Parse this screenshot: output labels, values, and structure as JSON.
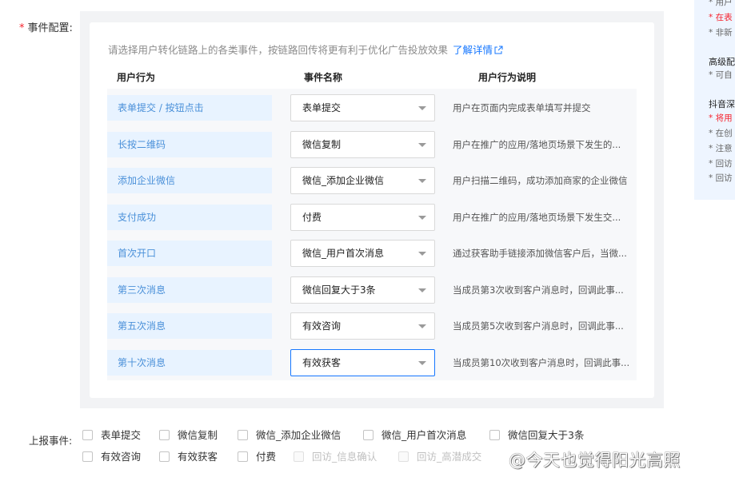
{
  "form": {
    "required_mark": "*",
    "event_config_label": "事件配置:",
    "hint_text": "请选择用户转化链路上的各类事件，按链路回传将更有利于优化广告投放效果",
    "learn_more": "了解详情",
    "headers": {
      "behavior": "用户行为",
      "event_name": "事件名称",
      "description": "用户行为说明"
    },
    "rows": [
      {
        "behavior": "表单提交 / 按钮点击",
        "event": "表单提交",
        "desc": "用户在页面内完成表单填写并提交"
      },
      {
        "behavior": "长按二维码",
        "event": "微信复制",
        "desc": "用户在推广的应用/落地页场景下发生的..."
      },
      {
        "behavior": "添加企业微信",
        "event": "微信_添加企业微信",
        "desc": "用户扫描二维码，成功添加商家的企业微信"
      },
      {
        "behavior": "支付成功",
        "event": "付费",
        "desc": "用户在推广的应用/落地页场景下发生交..."
      },
      {
        "behavior": "首次开口",
        "event": "微信_用户首次消息",
        "desc": "通过获客助手链接添加微信客户后，当微..."
      },
      {
        "behavior": "第三次消息",
        "event": "微信回复大于3条",
        "desc": "当成员第3次收到客户消息时，回调此事..."
      },
      {
        "behavior": "第五次消息",
        "event": "有效咨询",
        "desc": "当成员第5次收到客户消息时，回调此事..."
      },
      {
        "behavior": "第十次消息",
        "event": "有效获客",
        "desc": "当成员第10次收到客户消息时，回调此事..."
      }
    ]
  },
  "report": {
    "label": "上报事件:",
    "items": [
      {
        "label": "表单提交",
        "disabled": false
      },
      {
        "label": "微信复制",
        "disabled": false
      },
      {
        "label": "微信_添加企业微信",
        "disabled": false
      },
      {
        "label": "微信_用户首次消息",
        "disabled": false
      },
      {
        "label": "微信回复大于3条",
        "disabled": false
      },
      {
        "label": "有效咨询",
        "disabled": false
      },
      {
        "label": "有效获客",
        "disabled": false
      },
      {
        "label": "付费",
        "disabled": false
      },
      {
        "label": "回访_信息确认",
        "disabled": true
      },
      {
        "label": "回访_高潜成交",
        "disabled": true
      }
    ]
  },
  "side_panel": {
    "lines": [
      "* 用户",
      "* 在表",
      "* 非新",
      "高级配",
      "* 可自",
      "抖音深",
      "* 将用",
      "* 在创",
      "* 注意",
      "* 回访",
      "* 回访"
    ]
  },
  "watermark": "@今天也觉得阳光高照",
  "colors": {
    "accent": "#1677ff",
    "required": "#f5222d",
    "behavior_bg": "#e8f3ff",
    "behavior_text": "#4a90d9"
  }
}
